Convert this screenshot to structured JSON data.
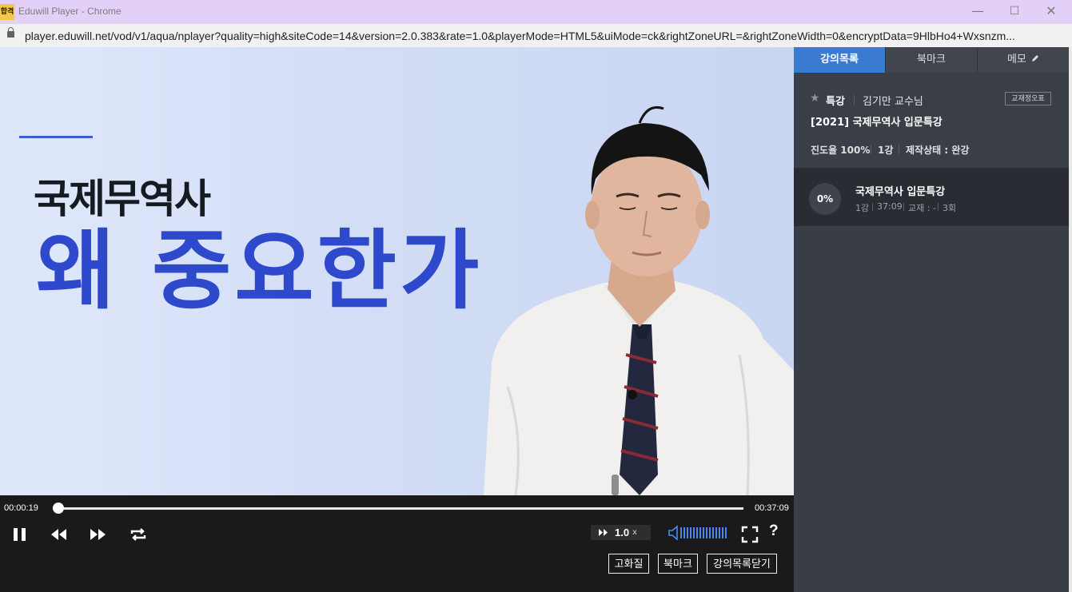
{
  "window": {
    "app_icon_text": "합격",
    "title": "Eduwill Player - Chrome",
    "minimize": "—",
    "maximize": "☐",
    "close": "✕"
  },
  "browser": {
    "url": "player.eduwill.net/vod/v1/aqua/nplayer?quality=high&siteCode=14&version=2.0.383&rate=1.0&playerMode=HTML5&uiMode=ck&rightZoneURL=&rightZoneWidth=0&encryptData=9HlbHo4+Wxsnzm..."
  },
  "video": {
    "slide_subtitle": "국제무역사",
    "slide_title": "왜 중요한가"
  },
  "player": {
    "current_time": "00:00:19",
    "total_time": "00:37:09",
    "progress_fraction": 0.0085,
    "speed_value": "1.0",
    "speed_suffix": "x",
    "help": "?",
    "buttons": {
      "quality": "고화질",
      "bookmark": "북마크",
      "close_list": "강의목록닫기"
    },
    "icons": [
      "pause-icon",
      "rewind-icon",
      "fast-forward-icon",
      "repeat-icon",
      "speed-icon",
      "volume-icon",
      "fullscreen-icon"
    ]
  },
  "sidebar": {
    "tabs": [
      {
        "label": "강의목록",
        "active": true
      },
      {
        "label": "북마크",
        "active": false
      },
      {
        "label": "메모",
        "active": false
      }
    ],
    "course": {
      "category": "특강",
      "professor": "김기만 교수님",
      "errata_button": "교재정오표",
      "title": "[2021] 국제무역사 입문특강",
      "progress": "진도율 100%",
      "lecture_count": "1강",
      "status": "제작상태 : 완강"
    },
    "lecture": {
      "percent": "0%",
      "title": "국제무역사 입문특강",
      "number": "1강",
      "duration": "37:09",
      "textbook": "교재 : -",
      "views": "3회"
    }
  },
  "colors": {
    "accent": "#3a7ad1",
    "slide_title": "#2f49cd",
    "titlebar": "#e3d0f7"
  }
}
